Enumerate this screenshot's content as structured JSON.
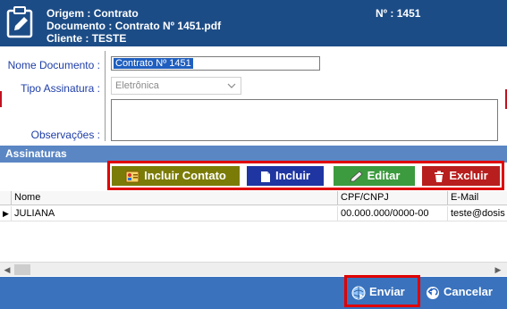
{
  "header": {
    "origem_label": "Origem :",
    "origem_value": "Contrato",
    "documento_label": "Documento :",
    "documento_value": "Contrato Nº 1451.pdf",
    "cliente_label": "Cliente :",
    "cliente_value": "TESTE",
    "numero_label": "Nº :",
    "numero_value": "1451"
  },
  "form": {
    "nome_documento_label": "Nome Documento :",
    "nome_documento_value": "Contrato Nº 1451",
    "tipo_assinatura_label": "Tipo Assinatura :",
    "tipo_assinatura_value": "Eletrônica",
    "observacoes_label": "Observações :",
    "observacoes_value": ""
  },
  "section": {
    "title": "Assinaturas"
  },
  "actions": {
    "incluir_contato": "Incluir Contato",
    "incluir": "Incluir",
    "editar": "Editar",
    "excluir": "Excluir"
  },
  "grid": {
    "columns": [
      "Nome",
      "CPF/CNPJ",
      "E-Mail"
    ],
    "rows": [
      {
        "nome": "JULIANA",
        "cpf": "00.000.000/0000-00",
        "email": "teste@dosis"
      }
    ]
  },
  "footer": {
    "enviar": "Enviar",
    "cancelar": "Cancelar"
  },
  "colors": {
    "header_bg": "#1c4c86",
    "section_bg": "#5a86c4",
    "footer_bg": "#3a72bd",
    "highlight_red": "#e00000",
    "btn_incluir_contato": "#7b7b08",
    "btn_incluir": "#1f35a1",
    "btn_editar": "#3c9b3e",
    "btn_excluir": "#b81e1e",
    "label_blue": "#1f3ea8"
  },
  "icons": {
    "header": "document-edit-icon",
    "incluir_contato": "contact-card-icon",
    "incluir": "document-icon",
    "editar": "pencil-icon",
    "excluir": "trash-icon",
    "enviar": "send-globe-icon",
    "cancelar": "undo-icon"
  }
}
